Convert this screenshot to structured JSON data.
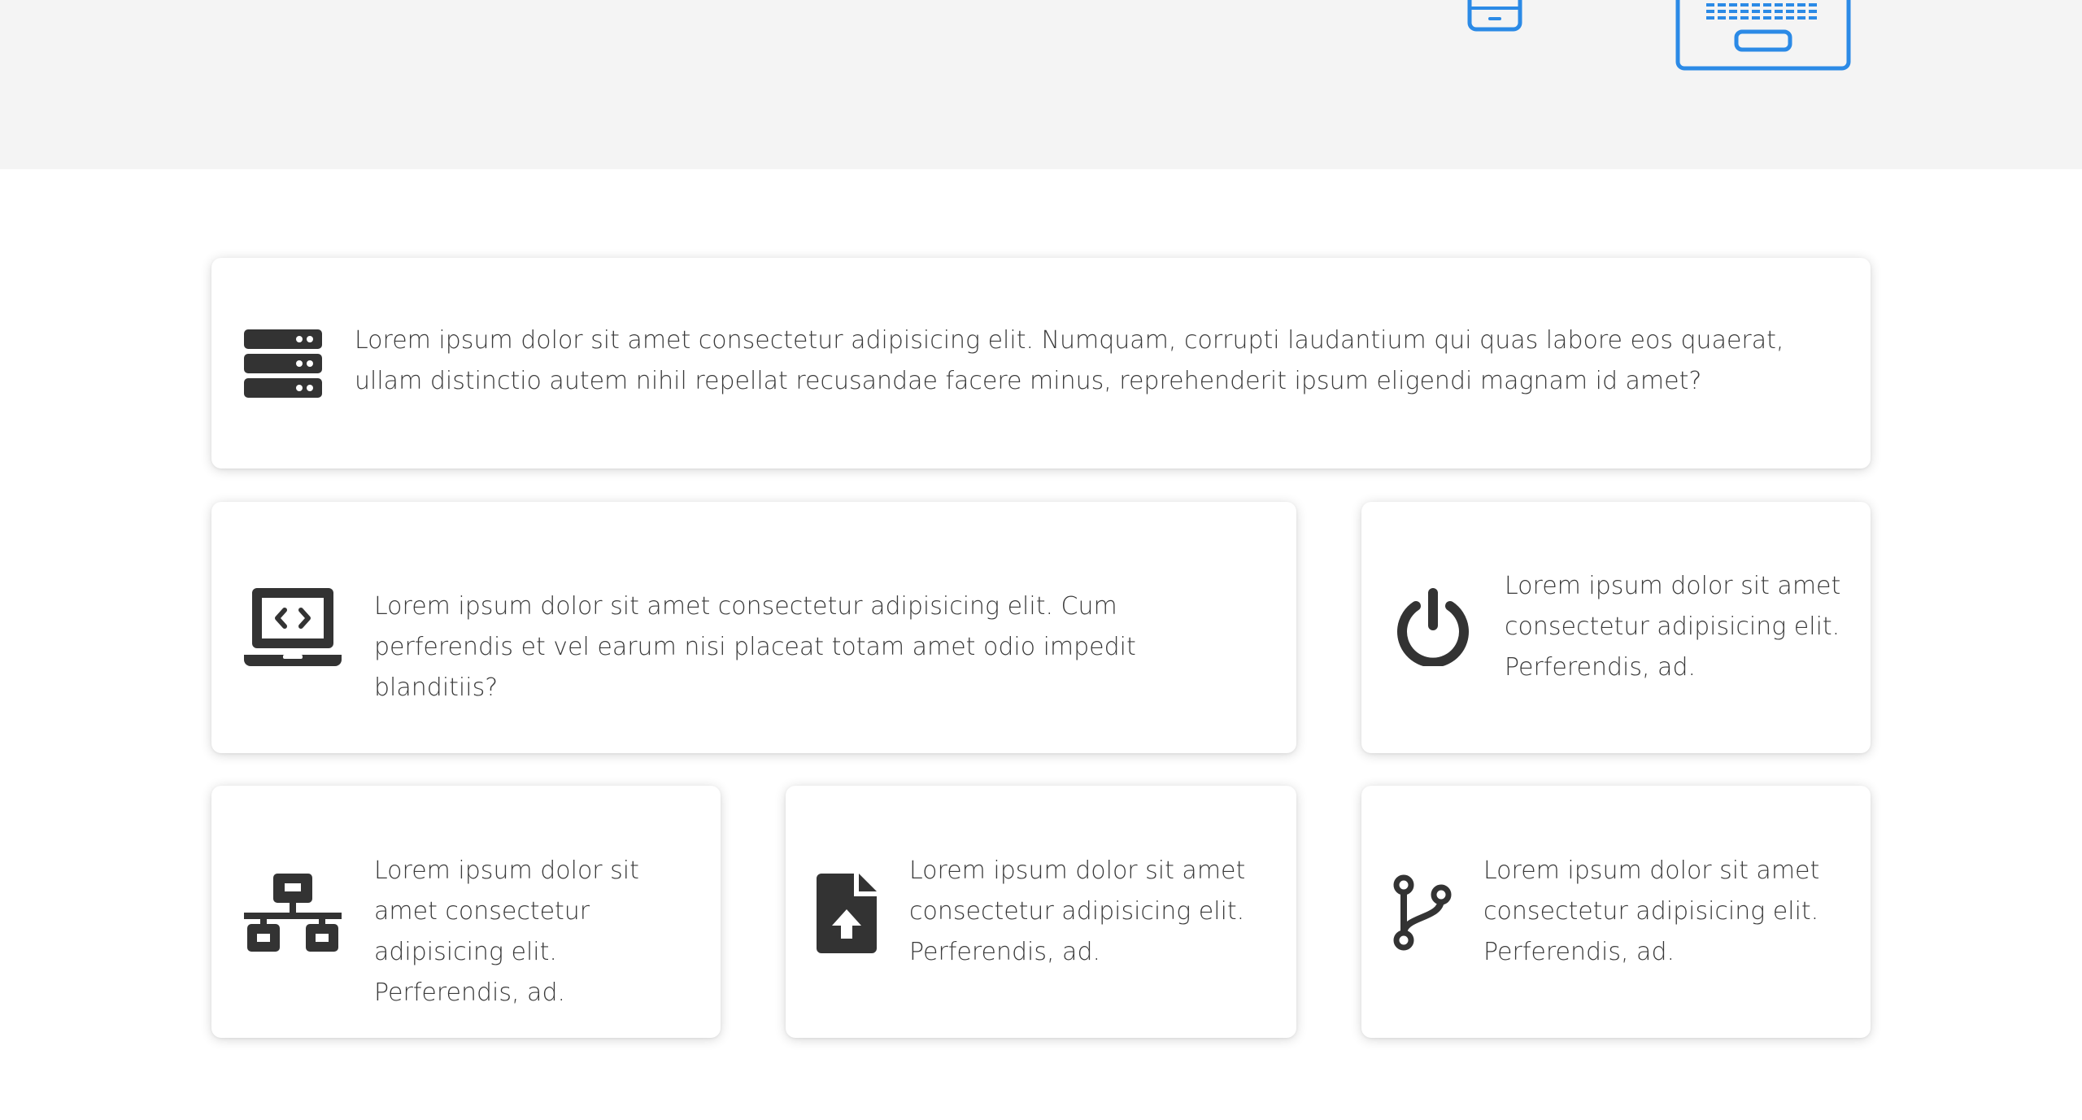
{
  "colors": {
    "hero_background": "#f4f4f4",
    "accent": "#2b8ae6",
    "icon": "#333333",
    "text": "#3a3a3a"
  },
  "hero": {
    "icons": [
      "phone-device-icon",
      "tablet-device-icon"
    ]
  },
  "features": [
    {
      "icon": "server-icon",
      "text": "Lorem ipsum dolor sit amet consectetur adipisicing elit. Numquam, corrupti laudantium qui quas labore eos quaerat, ullam distinctio autem nihil repellat recusandae facere minus, reprehenderit ipsum eligendi magnam id amet?"
    },
    {
      "icon": "laptop-code-icon",
      "text": "Lorem ipsum dolor sit amet consectetur adipisicing elit. Cum perferendis et vel earum nisi placeat totam amet odio impedit blanditiis?"
    },
    {
      "icon": "power-icon",
      "text": "Lorem ipsum dolor sit amet consectetur adipisicing elit. Perferendis, ad."
    },
    {
      "icon": "network-icon",
      "text": "Lorem ipsum dolor sit amet consectetur adipisicing elit. Perferendis, ad."
    },
    {
      "icon": "file-upload-icon",
      "text": "Lorem ipsum dolor sit amet consectetur adipisicing elit. Perferendis, ad."
    },
    {
      "icon": "code-branch-icon",
      "text": "Lorem ipsum dolor sit amet consectetur adipisicing elit. Perferendis, ad."
    }
  ]
}
